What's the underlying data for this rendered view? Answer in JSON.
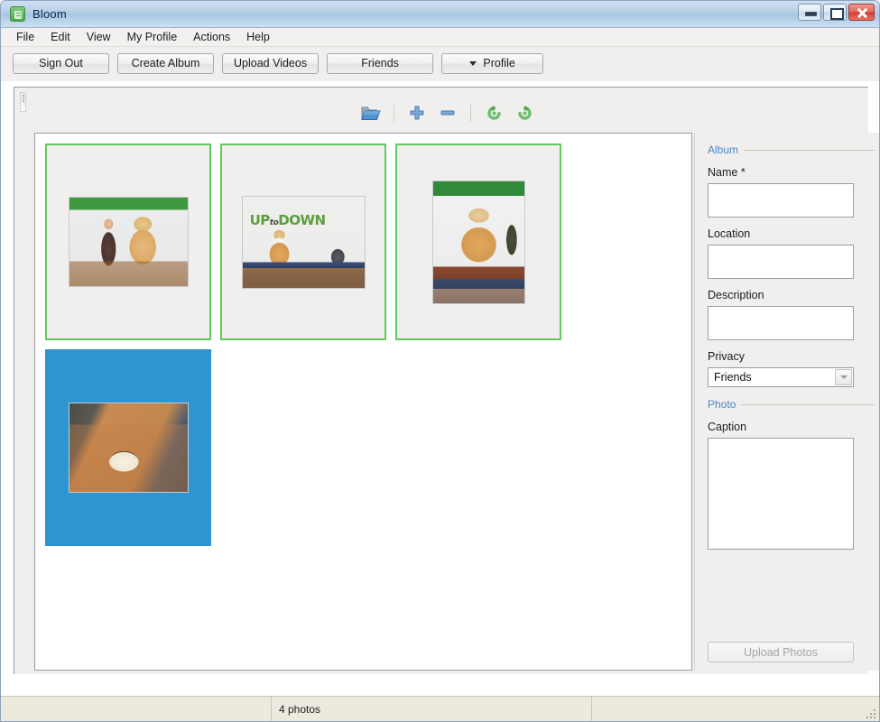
{
  "window": {
    "title": "Bloom",
    "app_icon": "bloom-logo-icon",
    "controls": {
      "minimize": "minimize-icon",
      "maximize": "maximize-icon",
      "close": "close-icon"
    }
  },
  "menubar": {
    "items": [
      {
        "label": "File"
      },
      {
        "label": "Edit"
      },
      {
        "label": "View"
      },
      {
        "label": "My Profile"
      },
      {
        "label": "Actions"
      },
      {
        "label": "Help"
      }
    ]
  },
  "toolbar": {
    "sign_out": "Sign Out",
    "create_album": "Create Album",
    "upload_videos": "Upload Videos",
    "friends": "Friends",
    "profile": "Profile"
  },
  "icon_toolbar": {
    "open_folder": "open-folder-icon",
    "add": "plus-icon",
    "remove": "minus-icon",
    "rotate_left": "rotate-left-icon",
    "rotate_right": "rotate-right-icon"
  },
  "photos": [
    {
      "index": 1,
      "name": "photo-person-with-mascot",
      "orientation": "landscape",
      "selected": false,
      "caption_text": ""
    },
    {
      "index": 2,
      "name": "photo-uptodown-wall",
      "orientation": "landscape",
      "selected": false,
      "logo_up": "UP",
      "logo_to": "to",
      "logo_down": "DOWN",
      "caption_text": ""
    },
    {
      "index": 3,
      "name": "photo-mascot-on-stool",
      "orientation": "portrait",
      "selected": false,
      "caption_text": ""
    },
    {
      "index": 4,
      "name": "photo-birthday-cake",
      "orientation": "landscape",
      "selected": true,
      "caption_text": ""
    }
  ],
  "form": {
    "album_section": "Album",
    "name_label": "Name *",
    "name_value": "",
    "name_placeholder": "",
    "location_label": "Location",
    "location_value": "",
    "location_placeholder": "",
    "description_label": "Description",
    "description_value": "",
    "description_placeholder": "",
    "privacy_label": "Privacy",
    "privacy_value": "Friends",
    "privacy_options": [
      "Friends"
    ],
    "photo_section": "Photo",
    "caption_label": "Caption",
    "caption_value": "",
    "caption_placeholder": "",
    "upload_button": "Upload Photos",
    "upload_button_enabled": false
  },
  "statusbar": {
    "left": "",
    "center": "4 photos",
    "right": ""
  },
  "colors": {
    "selection_blue": "#2e95d3",
    "thumb_border_green": "#5ecb5e",
    "section_header_blue": "#4a87c8",
    "titlebar_blue": "#a9c6e2",
    "close_red": "#cf3b2d"
  }
}
